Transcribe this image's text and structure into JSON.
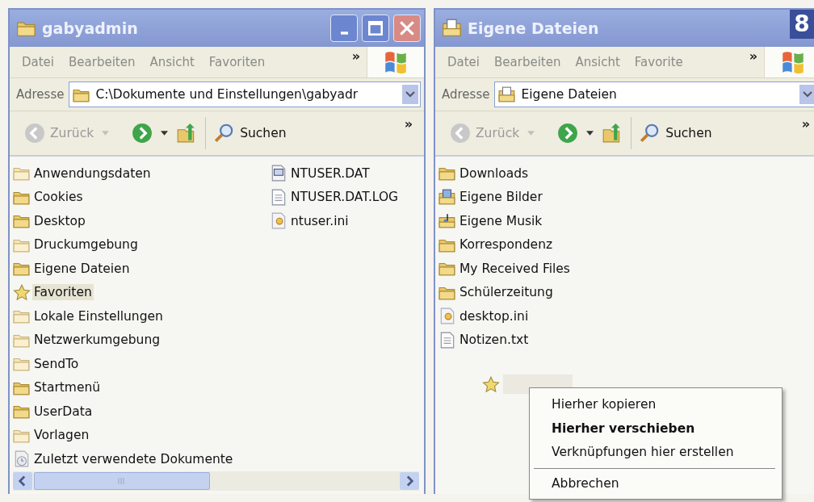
{
  "windows": [
    {
      "title": "gabyadmin",
      "kind": "folder",
      "caption_buttons": true,
      "menu": [
        "Datei",
        "Bearbeiten",
        "Ansicht",
        "Favoriten"
      ],
      "menu_more": "»",
      "address": {
        "label": "Adresse",
        "value": "C:\\Dokumente und Einstellungen\\gabyadr"
      },
      "toolbar": {
        "back": "Zurück",
        "search": "Suchen",
        "more": "»"
      },
      "columns": [
        [
          {
            "name": "Anwendungsdaten",
            "kind": "folder-pale",
            "selected": false
          },
          {
            "name": "Cookies",
            "kind": "folder",
            "selected": false
          },
          {
            "name": "Desktop",
            "kind": "folder",
            "selected": false
          },
          {
            "name": "Druckumgebung",
            "kind": "folder-pale",
            "selected": false
          },
          {
            "name": "Eigene Dateien",
            "kind": "folder",
            "selected": false
          },
          {
            "name": "Favoriten",
            "kind": "star",
            "selected": true
          },
          {
            "name": "Lokale Einstellungen",
            "kind": "folder-pale",
            "selected": false
          },
          {
            "name": "Netzwerkumgebung",
            "kind": "folder-pale",
            "selected": false
          },
          {
            "name": "SendTo",
            "kind": "folder-pale",
            "selected": false
          },
          {
            "name": "Startmenü",
            "kind": "folder",
            "selected": false
          },
          {
            "name": "UserData",
            "kind": "folder",
            "selected": false
          },
          {
            "name": "Vorlagen",
            "kind": "folder-pale",
            "selected": false
          },
          {
            "name": "Zuletzt verwendete Dokumente",
            "kind": "recent",
            "selected": false
          }
        ],
        [
          {
            "name": "NTUSER.DAT",
            "kind": "system-file",
            "selected": false
          },
          {
            "name": "NTUSER.DAT.LOG",
            "kind": "text-file",
            "selected": false
          },
          {
            "name": "ntuser.ini",
            "kind": "settings-file",
            "selected": false
          }
        ]
      ],
      "h_scrollbar": true
    },
    {
      "title": "Eigene Dateien",
      "kind": "documents",
      "caption_buttons": false,
      "menu": [
        "Datei",
        "Bearbeiten",
        "Ansicht",
        "Favorite"
      ],
      "menu_more": "»",
      "address": {
        "label": "Adresse",
        "value": "Eigene Dateien"
      },
      "toolbar": {
        "back": "Zurück",
        "search": "Suchen",
        "more": "»"
      },
      "columns": [
        [
          {
            "name": "Downloads",
            "kind": "folder",
            "selected": false
          },
          {
            "name": "Eigene Bilder",
            "kind": "pictures-folder",
            "selected": false
          },
          {
            "name": "Eigene Musik",
            "kind": "music-folder",
            "selected": false
          },
          {
            "name": "Korrespondenz",
            "kind": "folder",
            "selected": false
          },
          {
            "name": "My Received Files",
            "kind": "folder",
            "selected": false
          },
          {
            "name": "Schülerzeitung",
            "kind": "folder",
            "selected": false
          },
          {
            "name": "desktop.ini",
            "kind": "settings-file",
            "selected": false
          },
          {
            "name": "Notizen.txt",
            "kind": "text-file",
            "selected": false
          }
        ]
      ],
      "h_scrollbar": false,
      "drag_ghost": {
        "kind": "star"
      },
      "context_menu": [
        {
          "kind": "item",
          "label": "Hierher kopieren",
          "default": false
        },
        {
          "kind": "item",
          "label": "Hierher verschieben",
          "default": true
        },
        {
          "kind": "item",
          "label": "Verknüpfungen hier erstellen",
          "default": false
        },
        {
          "kind": "separator"
        },
        {
          "kind": "item",
          "label": "Abbrechen",
          "default": false
        }
      ]
    }
  ],
  "step_number": "8"
}
